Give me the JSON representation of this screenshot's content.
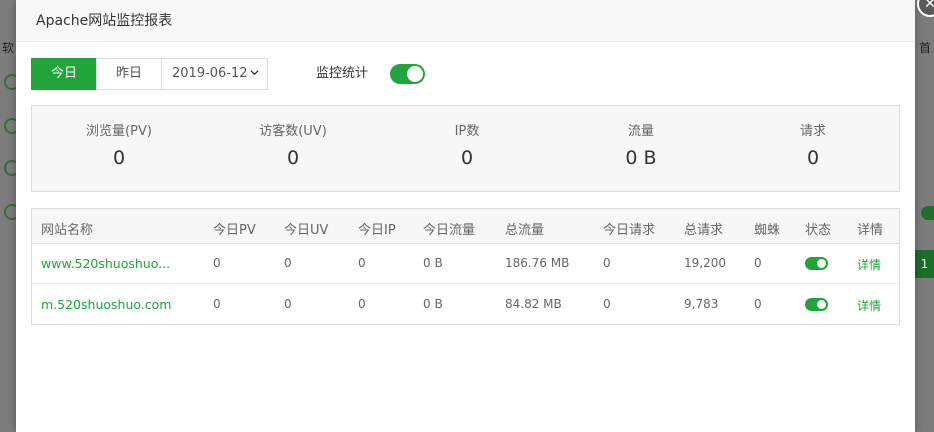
{
  "background": {
    "left_label": "软",
    "right_label": "首",
    "right_page_button": "1"
  },
  "dialog": {
    "title": "Apache网站监控报表",
    "close_glyph": "✕"
  },
  "toolbar": {
    "today": "今日",
    "yesterday": "昨日",
    "date": "2019-06-12",
    "stat_label": "监控统计",
    "stat_enabled": true
  },
  "summary": [
    {
      "label": "浏览量(PV)",
      "value": "0"
    },
    {
      "label": "访客数(UV)",
      "value": "0"
    },
    {
      "label": "IP数",
      "value": "0"
    },
    {
      "label": "流量",
      "value": "0 B"
    },
    {
      "label": "请求",
      "value": "0"
    }
  ],
  "table": {
    "columns": [
      "网站名称",
      "今日PV",
      "今日UV",
      "今日IP",
      "今日流量",
      "总流量",
      "今日请求",
      "总请求",
      "蜘蛛",
      "状态",
      "详情"
    ],
    "rows": [
      {
        "site": "www.520shuoshuo...",
        "pv": "0",
        "uv": "0",
        "ip": "0",
        "flow": "0 B",
        "total_flow": "186.76 MB",
        "req": "0",
        "total_req": "19,200",
        "spider": "0",
        "status_on": true,
        "detail": "详情"
      },
      {
        "site": "m.520shuoshuo.com",
        "pv": "0",
        "uv": "0",
        "ip": "0",
        "flow": "0 B",
        "total_flow": "84.82 MB",
        "req": "0",
        "total_req": "9,783",
        "spider": "0",
        "status_on": true,
        "detail": "详情"
      }
    ]
  },
  "colors": {
    "accent": "#20a53a",
    "overlay": "#7c7c7c"
  }
}
